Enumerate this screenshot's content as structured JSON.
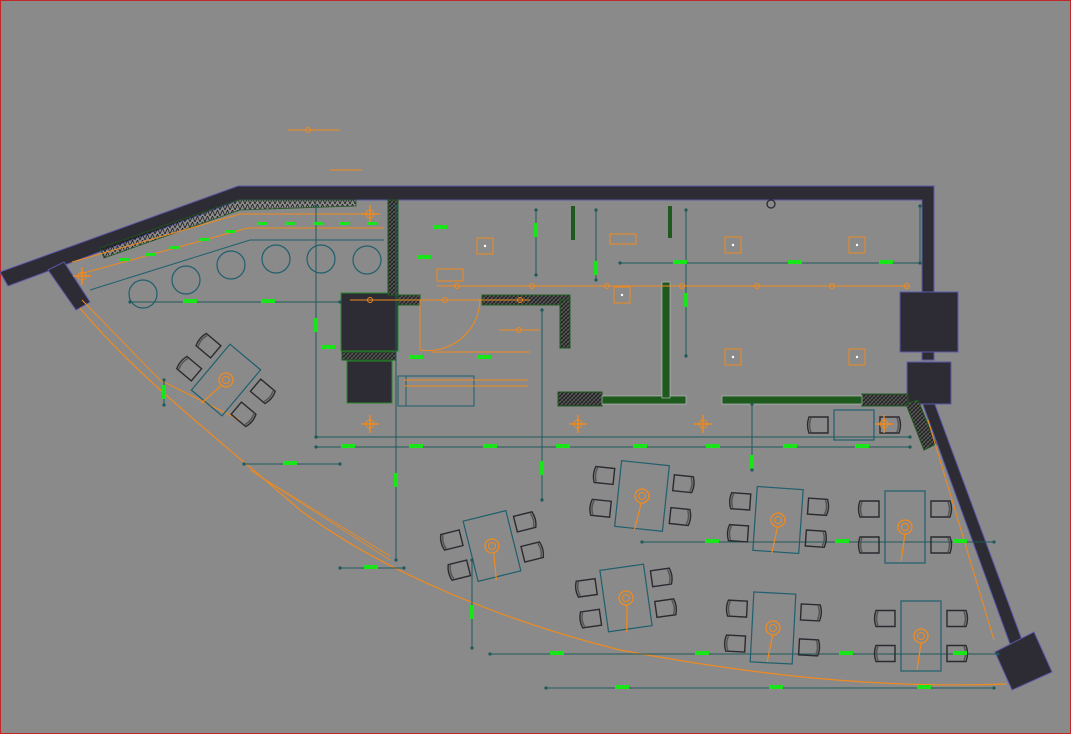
{
  "drawing": {
    "colors": {
      "background": "#8a8a8a",
      "wall": "#2d2b33",
      "wall_outline": "#5a58a8",
      "furniture": "#1f5f6e",
      "chair": "#2a2a30",
      "lighting": "#f08a1e",
      "dimension": "#1e5a5a",
      "dim_text": "#19e619",
      "partition": "#1e5a1e",
      "pattern": "#1c1c1c",
      "frame": "#c0282a"
    }
  }
}
